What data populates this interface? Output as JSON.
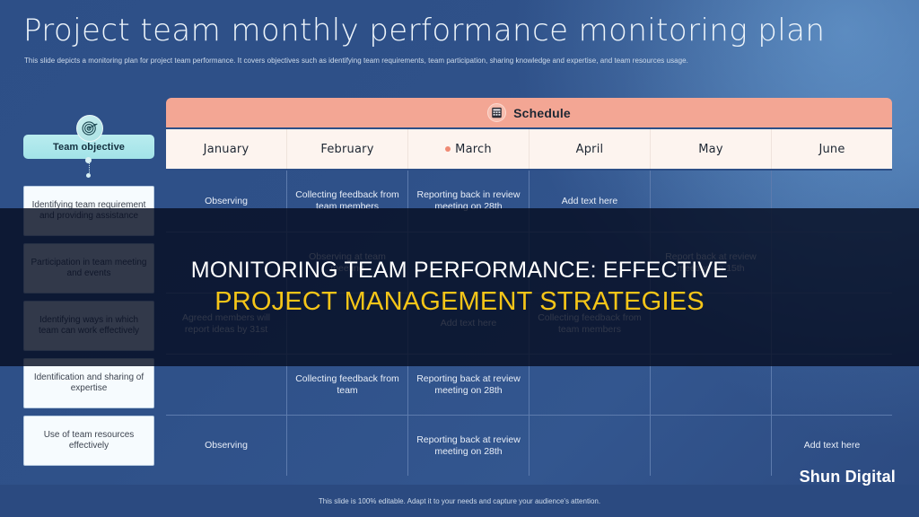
{
  "slide": {
    "title": "Project team monthly performance monitoring plan",
    "subtitle": "This slide depicts a monitoring plan for project team performance. It covers objectives such as identifying team requirements, team participation,  sharing knowledge and expertise, and team resources usage.",
    "footer": "This slide is 100% editable. Adapt it to your needs and capture your audience's attention.",
    "watermark": "Shun Digital"
  },
  "colors": {
    "background_blue": "#2d4f87",
    "schedule_bar": "#f3a694",
    "month_header": "#fdf4ef",
    "objective_pill": "#a2e3e8",
    "accent_yellow": "#f5c518",
    "month_dot": "#ef8a74"
  },
  "left_column": {
    "badge_icon": "target-icon",
    "objective_label": "Team objective",
    "items": [
      {
        "label": "Identifying  team requirement and providing assistance"
      },
      {
        "label": "Participation in team meeting and events"
      },
      {
        "label": "Identifying  ways in which  team can work effectively"
      },
      {
        "label": "Identification and sharing of expertise"
      },
      {
        "label": "Use of team resources effectively"
      }
    ]
  },
  "schedule": {
    "icon": "calendar-icon",
    "label": "Schedule",
    "months": [
      {
        "name": "January",
        "dot": false
      },
      {
        "name": "February",
        "dot": false
      },
      {
        "name": "March",
        "dot": true
      },
      {
        "name": "April",
        "dot": false
      },
      {
        "name": "May",
        "dot": false
      },
      {
        "name": "June",
        "dot": false
      }
    ],
    "rows": [
      {
        "cells": [
          "Observing",
          "Collecting feedback from team members",
          "Reporting back in review meeting on 28th",
          "Add text here",
          "",
          ""
        ]
      },
      {
        "cells": [
          "",
          "Observing at team meeting",
          "",
          "",
          "Report back at review meeting on 15th",
          ""
        ]
      },
      {
        "cells": [
          "Agreed members will report ideas by 31st",
          "",
          "Add text here",
          "Collecting feedback from team members",
          "",
          ""
        ]
      },
      {
        "cells": [
          "",
          "Collecting feedback from team",
          "Reporting back at review meeting on 28th",
          "",
          "",
          ""
        ]
      },
      {
        "cells": [
          "Observing",
          "",
          "Reporting back at review meeting on 28th",
          "",
          "",
          "Add text here"
        ]
      }
    ]
  },
  "overlay": {
    "line1": "MONITORING TEAM PERFORMANCE: EFFECTIVE",
    "line2": "PROJECT MANAGEMENT STRATEGIES"
  }
}
